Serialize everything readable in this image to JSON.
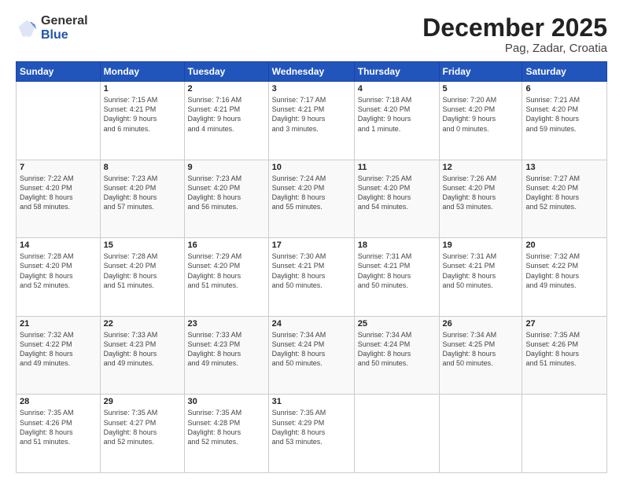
{
  "logo": {
    "general": "General",
    "blue": "Blue"
  },
  "title": {
    "month": "December 2025",
    "location": "Pag, Zadar, Croatia"
  },
  "headers": [
    "Sunday",
    "Monday",
    "Tuesday",
    "Wednesday",
    "Thursday",
    "Friday",
    "Saturday"
  ],
  "weeks": [
    [
      {
        "day": "",
        "info": ""
      },
      {
        "day": "1",
        "info": "Sunrise: 7:15 AM\nSunset: 4:21 PM\nDaylight: 9 hours\nand 6 minutes."
      },
      {
        "day": "2",
        "info": "Sunrise: 7:16 AM\nSunset: 4:21 PM\nDaylight: 9 hours\nand 4 minutes."
      },
      {
        "day": "3",
        "info": "Sunrise: 7:17 AM\nSunset: 4:21 PM\nDaylight: 9 hours\nand 3 minutes."
      },
      {
        "day": "4",
        "info": "Sunrise: 7:18 AM\nSunset: 4:20 PM\nDaylight: 9 hours\nand 1 minute."
      },
      {
        "day": "5",
        "info": "Sunrise: 7:20 AM\nSunset: 4:20 PM\nDaylight: 9 hours\nand 0 minutes."
      },
      {
        "day": "6",
        "info": "Sunrise: 7:21 AM\nSunset: 4:20 PM\nDaylight: 8 hours\nand 59 minutes."
      }
    ],
    [
      {
        "day": "7",
        "info": "Sunrise: 7:22 AM\nSunset: 4:20 PM\nDaylight: 8 hours\nand 58 minutes."
      },
      {
        "day": "8",
        "info": "Sunrise: 7:23 AM\nSunset: 4:20 PM\nDaylight: 8 hours\nand 57 minutes."
      },
      {
        "day": "9",
        "info": "Sunrise: 7:23 AM\nSunset: 4:20 PM\nDaylight: 8 hours\nand 56 minutes."
      },
      {
        "day": "10",
        "info": "Sunrise: 7:24 AM\nSunset: 4:20 PM\nDaylight: 8 hours\nand 55 minutes."
      },
      {
        "day": "11",
        "info": "Sunrise: 7:25 AM\nSunset: 4:20 PM\nDaylight: 8 hours\nand 54 minutes."
      },
      {
        "day": "12",
        "info": "Sunrise: 7:26 AM\nSunset: 4:20 PM\nDaylight: 8 hours\nand 53 minutes."
      },
      {
        "day": "13",
        "info": "Sunrise: 7:27 AM\nSunset: 4:20 PM\nDaylight: 8 hours\nand 52 minutes."
      }
    ],
    [
      {
        "day": "14",
        "info": "Sunrise: 7:28 AM\nSunset: 4:20 PM\nDaylight: 8 hours\nand 52 minutes."
      },
      {
        "day": "15",
        "info": "Sunrise: 7:28 AM\nSunset: 4:20 PM\nDaylight: 8 hours\nand 51 minutes."
      },
      {
        "day": "16",
        "info": "Sunrise: 7:29 AM\nSunset: 4:20 PM\nDaylight: 8 hours\nand 51 minutes."
      },
      {
        "day": "17",
        "info": "Sunrise: 7:30 AM\nSunset: 4:21 PM\nDaylight: 8 hours\nand 50 minutes."
      },
      {
        "day": "18",
        "info": "Sunrise: 7:31 AM\nSunset: 4:21 PM\nDaylight: 8 hours\nand 50 minutes."
      },
      {
        "day": "19",
        "info": "Sunrise: 7:31 AM\nSunset: 4:21 PM\nDaylight: 8 hours\nand 50 minutes."
      },
      {
        "day": "20",
        "info": "Sunrise: 7:32 AM\nSunset: 4:22 PM\nDaylight: 8 hours\nand 49 minutes."
      }
    ],
    [
      {
        "day": "21",
        "info": "Sunrise: 7:32 AM\nSunset: 4:22 PM\nDaylight: 8 hours\nand 49 minutes."
      },
      {
        "day": "22",
        "info": "Sunrise: 7:33 AM\nSunset: 4:23 PM\nDaylight: 8 hours\nand 49 minutes."
      },
      {
        "day": "23",
        "info": "Sunrise: 7:33 AM\nSunset: 4:23 PM\nDaylight: 8 hours\nand 49 minutes."
      },
      {
        "day": "24",
        "info": "Sunrise: 7:34 AM\nSunset: 4:24 PM\nDaylight: 8 hours\nand 50 minutes."
      },
      {
        "day": "25",
        "info": "Sunrise: 7:34 AM\nSunset: 4:24 PM\nDaylight: 8 hours\nand 50 minutes."
      },
      {
        "day": "26",
        "info": "Sunrise: 7:34 AM\nSunset: 4:25 PM\nDaylight: 8 hours\nand 50 minutes."
      },
      {
        "day": "27",
        "info": "Sunrise: 7:35 AM\nSunset: 4:26 PM\nDaylight: 8 hours\nand 51 minutes."
      }
    ],
    [
      {
        "day": "28",
        "info": "Sunrise: 7:35 AM\nSunset: 4:26 PM\nDaylight: 8 hours\nand 51 minutes."
      },
      {
        "day": "29",
        "info": "Sunrise: 7:35 AM\nSunset: 4:27 PM\nDaylight: 8 hours\nand 52 minutes."
      },
      {
        "day": "30",
        "info": "Sunrise: 7:35 AM\nSunset: 4:28 PM\nDaylight: 8 hours\nand 52 minutes."
      },
      {
        "day": "31",
        "info": "Sunrise: 7:35 AM\nSunset: 4:29 PM\nDaylight: 8 hours\nand 53 minutes."
      },
      {
        "day": "",
        "info": ""
      },
      {
        "day": "",
        "info": ""
      },
      {
        "day": "",
        "info": ""
      }
    ]
  ]
}
